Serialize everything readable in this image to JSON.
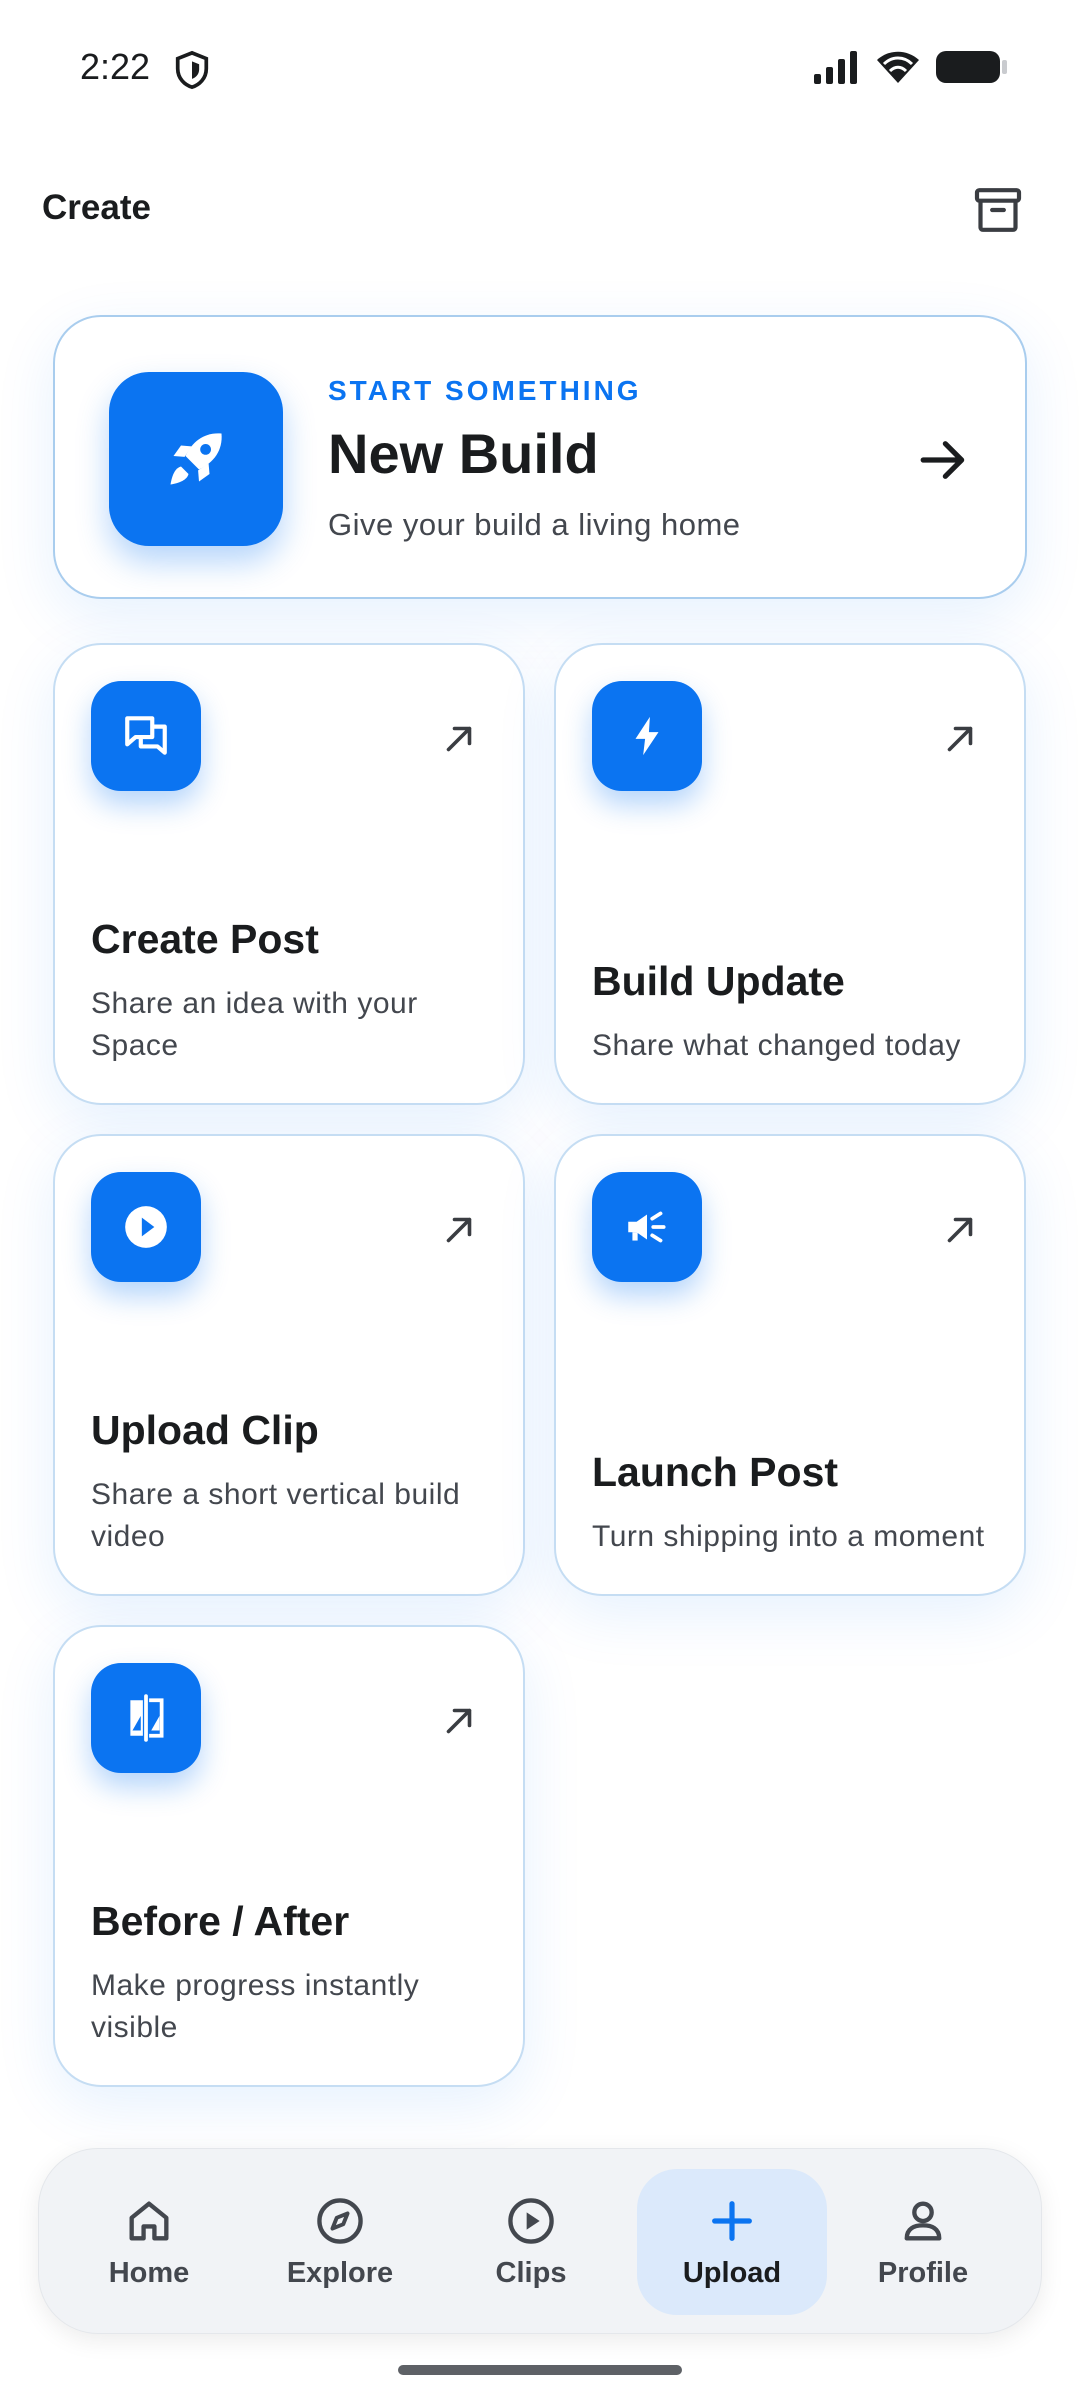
{
  "status": {
    "time": "2:22"
  },
  "header": {
    "title": "Create",
    "archive_icon": "archive-icon"
  },
  "hero": {
    "eyebrow": "START SOMETHING",
    "title": "New Build",
    "subtitle": "Give your build a living home",
    "icon": "rocket-icon"
  },
  "tiles": [
    {
      "title": "Create Post",
      "subtitle": "Share an idea with your Space",
      "icon": "forum-icon"
    },
    {
      "title": "Build Update",
      "subtitle": "Share what changed today",
      "icon": "bolt-icon"
    },
    {
      "title": "Upload Clip",
      "subtitle": "Share a short vertical build video",
      "icon": "play-circle-icon"
    },
    {
      "title": "Launch Post",
      "subtitle": "Turn shipping into a moment",
      "icon": "megaphone-icon"
    },
    {
      "title": "Before / After",
      "subtitle": "Make progress instantly visible",
      "icon": "compare-icon"
    }
  ],
  "nav": {
    "items": [
      {
        "label": "Home",
        "icon": "home-icon"
      },
      {
        "label": "Explore",
        "icon": "compass-icon"
      },
      {
        "label": "Clips",
        "icon": "play-icon"
      },
      {
        "label": "Upload",
        "icon": "plus-icon",
        "active": true
      },
      {
        "label": "Profile",
        "icon": "person-icon"
      }
    ]
  },
  "colors": {
    "accent": "#0b74f1",
    "card_border": "#c5ddf3",
    "nav_bg": "#f1f3f6",
    "active_pill": "#dbe9fb"
  }
}
